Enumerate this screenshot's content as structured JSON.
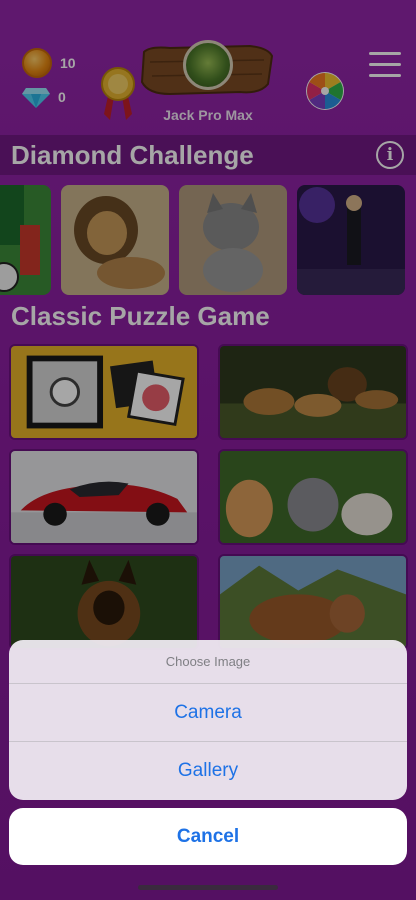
{
  "header": {
    "coins": "10",
    "diamonds": "0",
    "username": "Jack Pro Max",
    "icons": [
      "coin-icon",
      "diamond-icon",
      "medal-icon",
      "avatar",
      "color-wheel-icon",
      "menu-icon"
    ]
  },
  "sections": {
    "diamond_challenge": "Diamond Challenge",
    "classic_puzzle": "Classic Puzzle Game",
    "info_label": "i"
  },
  "diamond_thumbnails": [
    "soccer",
    "lion",
    "kitten",
    "performer"
  ],
  "classic_tiles": [
    "gallery-puzzle",
    "lions",
    "red-sports-car",
    "kittens",
    "german-shepherd",
    "cow"
  ],
  "action_sheet": {
    "title": "Choose Image",
    "camera": "Camera",
    "gallery": "Gallery",
    "cancel": "Cancel"
  },
  "colors": {
    "background": "#8a1fa0",
    "action_blue": "#1e72e6",
    "sheet_bg": "#f0ebf2"
  }
}
